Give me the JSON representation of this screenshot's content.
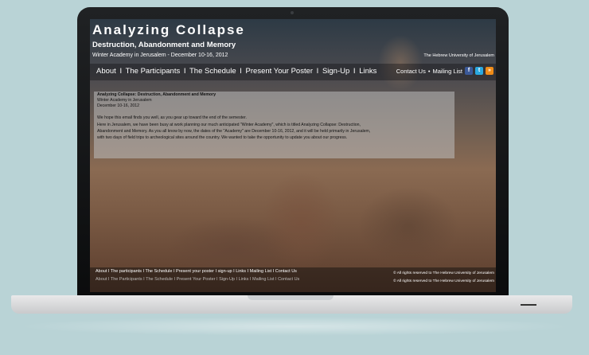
{
  "site": {
    "title": "Analyzing Collapse",
    "subtitle": "Destruction, Abandonment and Memory",
    "dates_line": "Winter Academy in Jerusalem - December 10-16, 2012",
    "university": "The Hebrew University of Jerusalem"
  },
  "nav": {
    "about": "About",
    "participants": "The Participants",
    "schedule": "The Schedule",
    "poster": "Present Your Poster",
    "signup": "Sign-Up",
    "links": "Links",
    "separator": "I",
    "contact": "Contact Us",
    "dot": "•",
    "mailing": "Mailing List"
  },
  "social": {
    "facebook_glyph": "f",
    "twitter_glyph": "t",
    "rss_glyph": "»",
    "facebook_color": "#3b5998",
    "twitter_color": "#2aa9e0",
    "rss_color": "#f08c18"
  },
  "content": {
    "title": "Analyzing Collapse: Destruction, Abandonment and Memory",
    "line2": "Winter Academy in Jerusalem",
    "line3": "December 10-16, 2012",
    "p1": "We hope this email finds you well, as you gear up toward the end of the semester.",
    "p2": "Here in Jerusalem, we have been busy at work planning our much anticipated \"Winter Academy\", which is titled Analyzing Collapse: Destruction,",
    "p3": "Abandonment and Memory. As you all know by now, the dates of the \"Academy\" are December 10-16, 2012, and it will be held primarily in Jerusalem,",
    "p4": "with two days of field trips to archeological sites around the country. We wanted to take the opportunity to update you about our progress."
  },
  "footer": {
    "nav": "About I The participants I The Schedule I Present your poster I sign-up I Links I Mailing List I Contact Us",
    "nav_duplicate": "About I The Participants I The Schedule I Present Your Poster I Sign-Up I Links I Mailing List I Contact Us",
    "copyright": "© All rights reserved to The Hebrew University of Jerusalem",
    "copyright_duplicate": "© All rights reserved to The Hebrew University of Jerusalem"
  }
}
